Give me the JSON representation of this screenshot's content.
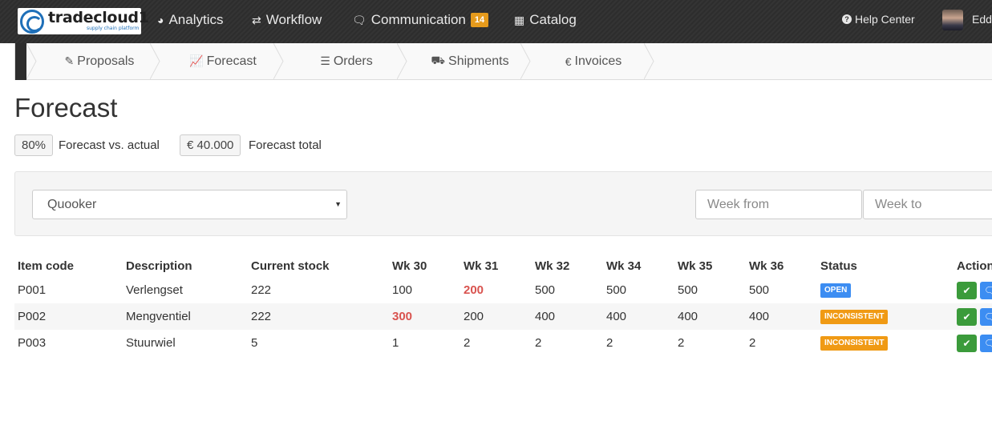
{
  "brand": {
    "name": "tradecloud1",
    "tagline": "supply chain platform"
  },
  "topnav": {
    "items": [
      {
        "label": "Analytics",
        "icon": "dashboard-icon"
      },
      {
        "label": "Workflow",
        "icon": "exchange-icon"
      },
      {
        "label": "Communication",
        "icon": "comments-icon",
        "badge": "14"
      },
      {
        "label": "Catalog",
        "icon": "grid-icon"
      }
    ],
    "help": "Help Center",
    "user": "Eddi"
  },
  "subnav": {
    "items": [
      {
        "label": "Proposals",
        "icon": "edit-icon"
      },
      {
        "label": "Forecast",
        "icon": "line-chart-icon"
      },
      {
        "label": "Orders",
        "icon": "list-icon"
      },
      {
        "label": "Shipments",
        "icon": "truck-icon"
      },
      {
        "label": "Invoices",
        "icon": "euro-icon"
      }
    ]
  },
  "page": {
    "title": "Forecast"
  },
  "stats": [
    {
      "value": "80%",
      "label": "Forecast vs. actual"
    },
    {
      "value": "€ 40.000",
      "label": "Forecast total"
    }
  ],
  "filters": {
    "supplier": "Quooker",
    "week_from_placeholder": "Week from",
    "week_to_placeholder": "Week to"
  },
  "table": {
    "headers": [
      "Item code",
      "Description",
      "Current stock",
      "Wk 30",
      "Wk 31",
      "Wk 32",
      "Wk 34",
      "Wk 35",
      "Wk 36",
      "Status",
      "Actions"
    ],
    "rows": [
      {
        "code": "P001",
        "desc": "Verlengset",
        "stock": "222",
        "wk30": "100",
        "wk31": "200",
        "wk32": "500",
        "wk34": "500",
        "wk35": "500",
        "wk36": "500",
        "status": "OPEN"
      },
      {
        "code": "P002",
        "desc": "Mengventiel",
        "stock": "222",
        "wk30": "300",
        "wk31": "200",
        "wk32": "400",
        "wk34": "400",
        "wk35": "400",
        "wk36": "400",
        "status": "INCONSISTENT"
      },
      {
        "code": "P003",
        "desc": "Stuurwiel",
        "stock": "5",
        "wk30": "1",
        "wk31": "2",
        "wk32": "2",
        "wk34": "2",
        "wk35": "2",
        "wk36": "2",
        "status": "INCONSISTENT"
      }
    ]
  }
}
